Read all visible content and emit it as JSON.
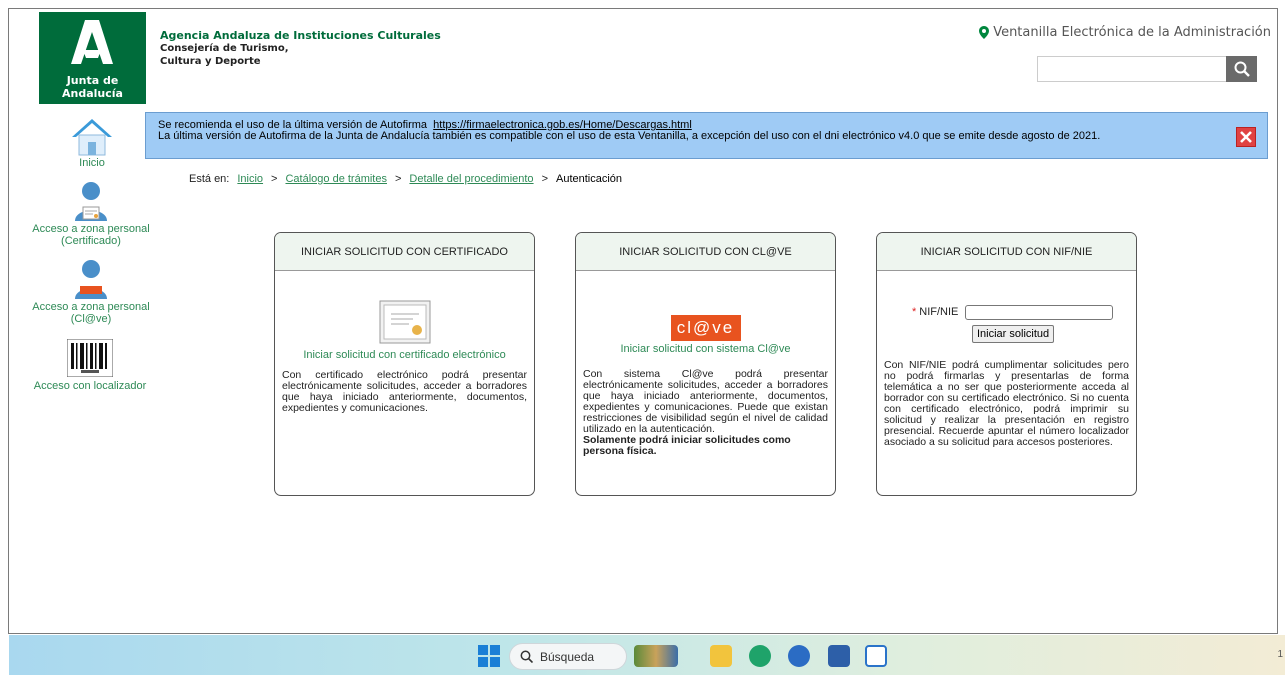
{
  "header": {
    "logo_text": "Junta de Andalucía",
    "agency": "Agencia Andaluza de Instituciones Culturales",
    "department": "Consejería de Turismo, Cultura y Deporte",
    "ventanilla": "Ventanilla Electrónica de la Administración",
    "search_placeholder": ""
  },
  "sidebar": {
    "inicio": "Inicio",
    "certificado": "Acceso a zona personal (Certificado)",
    "clave": "Acceso a zona personal (Cl@ve)",
    "localizador": "Acceso con localizador"
  },
  "notice": {
    "line1_prefix": "Se recomienda el uso de la última versión de Autofirma",
    "line1_link": "https://firmaelectronica.gob.es/Home/Descargas.html",
    "line2": "La última versión de Autofirma de la Junta de Andalucía también es compatible con el uso de esta Ventanilla, a excepción del uso con el dni electrónico v4.0 que se emite desde agosto de 2021."
  },
  "breadcrumb": {
    "prefix": "Está en:",
    "items": [
      "Inicio",
      "Catálogo de trámites",
      "Detalle del procedimiento"
    ],
    "current": "Autenticación",
    "sep": ">"
  },
  "cards": {
    "certificado": {
      "title": "INICIAR SOLICITUD CON CERTIFICADO",
      "link": "Iniciar solicitud con certificado electrónico",
      "desc": "Con certificado electrónico podrá presentar electrónicamente solicitudes, acceder a borradores que haya iniciado anteriormente, documentos, expedientes y comunicaciones."
    },
    "clave": {
      "title": "INICIAR SOLICITUD CON CL@VE",
      "logo": "cl@ve",
      "link": "Iniciar solicitud con sistema Cl@ve",
      "desc": "Con sistema Cl@ve podrá presentar electrónicamente solicitudes, acceder a borradores que haya iniciado anteriormente, documentos, expedientes y comunicaciones. Puede que existan restricciones de visibilidad según el nivel de calidad utilizado en la autenticación.",
      "bold": "Solamente podrá iniciar solicitudes como persona física."
    },
    "nif": {
      "title": "INICIAR SOLICITUD CON NIF/NIE",
      "label": "NIF/NIE",
      "required_mark": "*",
      "value": "",
      "button": "Iniciar solicitud",
      "desc": "Con NIF/NIE podrá cumplimentar solicitudes pero no podrá firmarlas y presentarlas de forma telemática a no ser que posteriormente acceda al borrador con su certificado electrónico. Si no cuenta con certificado electrónico, podrá imprimir su solicitud y realizar la presentación en registro presencial. Recuerde apuntar el número localizador asociado a su solicitud para accesos posteriores."
    }
  },
  "taskbar": {
    "search_label": "Búsqueda",
    "clock": "1"
  },
  "colors": {
    "green": "#006c3b",
    "link_green": "#2e8a56",
    "notice_blue": "#9fcbf5",
    "close_red": "#e04242",
    "clave_orange": "#e8531f"
  }
}
